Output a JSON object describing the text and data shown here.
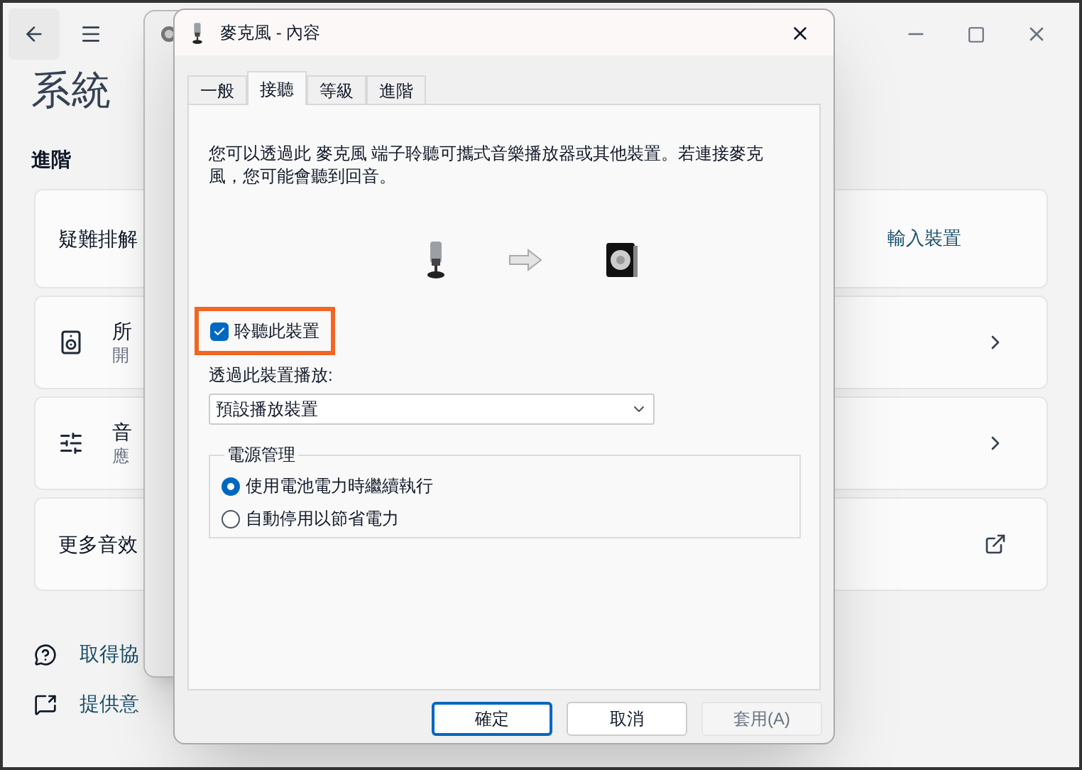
{
  "settings": {
    "heading": "系統",
    "section": "進階",
    "cards": [
      {
        "kind": "troubleshoot",
        "title": "疑難排解",
        "action": "輸入裝置"
      },
      {
        "kind": "speaker",
        "title": "所",
        "subtitle": "開"
      },
      {
        "kind": "mixer",
        "title": "音",
        "subtitle": "應"
      },
      {
        "kind": "external",
        "title": "更多音效"
      }
    ],
    "links": [
      {
        "kind": "help",
        "label": "取得協"
      },
      {
        "kind": "feedback",
        "label": "提供意"
      }
    ]
  },
  "dialog": {
    "title": "麥克風 - 內容",
    "tabs": [
      {
        "label": "一般",
        "selected": false
      },
      {
        "label": "接聽",
        "selected": true
      },
      {
        "label": "等級",
        "selected": false
      },
      {
        "label": "進階",
        "selected": false
      }
    ],
    "description": "您可以透過此 麥克風 端子聆聽可攜式音樂播放器或其他裝置。若連接麥克風，您可能會聽到回音。",
    "listen": {
      "label": "聆聽此裝置",
      "checked": true,
      "highlighted": true
    },
    "playback_label": "透過此裝置播放:",
    "playback_device": "預設播放裝置",
    "power": {
      "title": "電源管理",
      "options": [
        {
          "label": "使用電池電力時繼續執行",
          "selected": true
        },
        {
          "label": "自動停用以節省電力",
          "selected": false
        }
      ]
    },
    "buttons": [
      {
        "label": "確定",
        "kind": "default",
        "disabled": false
      },
      {
        "label": "取消",
        "kind": "normal",
        "disabled": false
      },
      {
        "label": "套用(A)",
        "kind": "normal",
        "disabled": true
      }
    ]
  }
}
